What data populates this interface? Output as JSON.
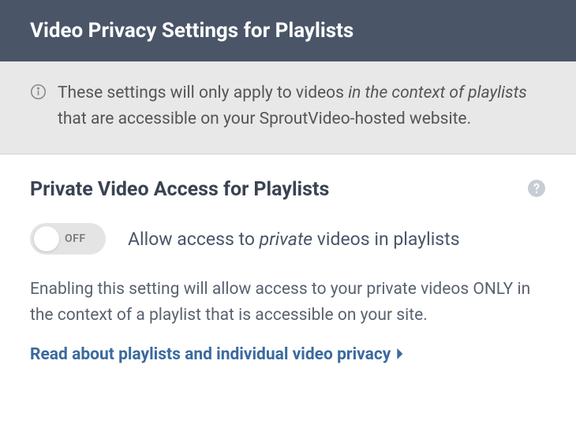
{
  "header": {
    "title": "Video Privacy Settings for Playlists"
  },
  "info_banner": {
    "prefix": "These settings will only apply to videos ",
    "italic": "in the context of playlists",
    "suffix": " that are accessible on your SproutVideo-hosted website."
  },
  "section": {
    "title": "Private Video Access for Playlists",
    "toggle_state": "OFF",
    "toggle_text_prefix": "Allow access to ",
    "toggle_text_italic": "private",
    "toggle_text_suffix": " videos in playlists",
    "description": "Enabling this setting will allow access to your private videos ONLY in the context of a playlist that is accessible on your site.",
    "link_text": "Read about playlists and individual video privacy"
  }
}
